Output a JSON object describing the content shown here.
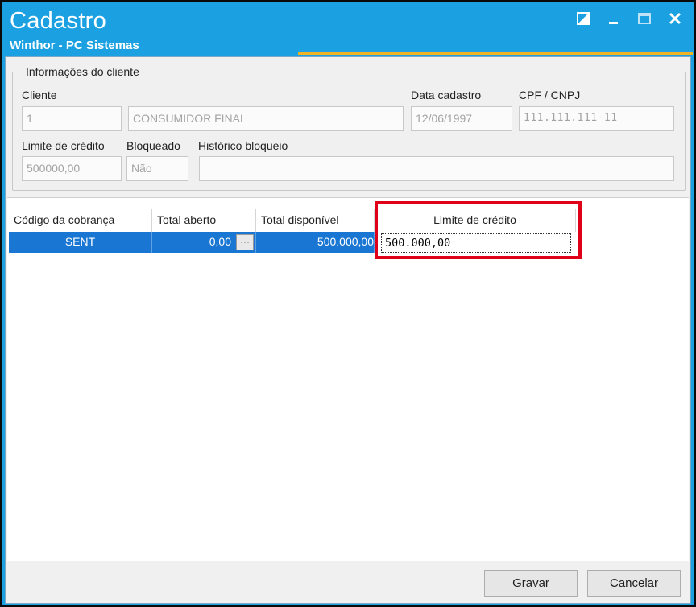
{
  "window": {
    "title": "Cadastro",
    "subtitle": "Winthor - PC Sistemas"
  },
  "client_info": {
    "legend": "Informações do cliente",
    "cliente_label": "Cliente",
    "cliente_code": "1",
    "cliente_name": "CONSUMIDOR FINAL",
    "data_cadastro_label": "Data cadastro",
    "data_cadastro": "12/06/1997",
    "cpf_label": "CPF / CNPJ",
    "cpf": "111.111.111-11",
    "limite_label": "Limite de crédito",
    "limite": "500000,00",
    "bloqueado_label": "Bloqueado",
    "bloqueado": "Não",
    "historico_label": "Histórico bloqueio",
    "historico": ""
  },
  "grid": {
    "columns": [
      "Código da cobrança",
      "Total aberto",
      "Total disponível",
      "Limite de crédito"
    ],
    "rows": [
      {
        "codigo": "SENT",
        "total_aberto": "0,00",
        "total_disponivel": "500.000,00",
        "limite": "500.000,00"
      }
    ]
  },
  "buttons": {
    "gravar_first": "G",
    "gravar_rest": "ravar",
    "cancelar_first": "C",
    "cancelar_rest": "ancelar"
  },
  "colors": {
    "titlebar": "#1ba1e2",
    "selected_row": "#1976d2",
    "highlight": "#e0001a",
    "accent": "#f0b323"
  }
}
